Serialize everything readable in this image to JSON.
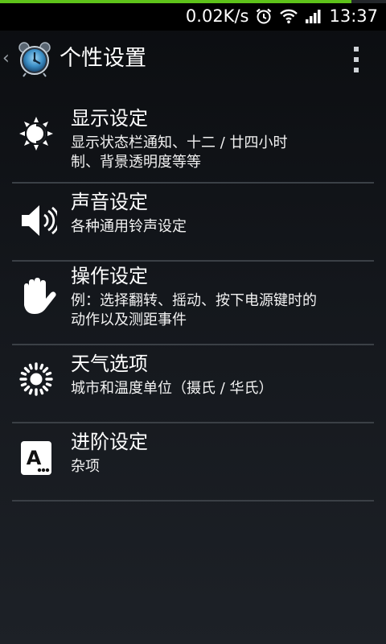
{
  "status_bar": {
    "download_progress": 0.91,
    "net_speed": "0.02K/s",
    "time": "13:37",
    "icons": [
      "alarm-icon",
      "wifi-icon",
      "signal-icon"
    ]
  },
  "action_bar": {
    "title": "个性设置",
    "icons": [
      "back-chevron-icon",
      "alarm-clock-app-icon",
      "overflow-menu-icon"
    ]
  },
  "settings": [
    {
      "title": "显示设定",
      "summary": [
        "显示状态栏通知、十二 / 廿四小时",
        "制、背景透明度等等"
      ],
      "icon": "brightness-icon"
    },
    {
      "title": "声音设定",
      "summary": [
        "各种通用铃声设定"
      ],
      "icon": "speaker-icon"
    },
    {
      "title": "操作设定",
      "summary": [
        "例：选择翻转、摇动、按下电源键时的",
        "动作以及测距事件"
      ],
      "icon": "hand-icon"
    },
    {
      "title": "天气选项",
      "summary": [
        "城市和温度单位（摄氏 / 华氏）"
      ],
      "icon": "sun-icon"
    },
    {
      "title": "进阶设定",
      "summary": [
        "杂项"
      ],
      "icon": "advanced-icon"
    }
  ],
  "colors": {
    "progress": "#5ec21a",
    "divider": "#3b4046",
    "background_top": "#0b0d10",
    "background_bottom": "#1d2127"
  }
}
